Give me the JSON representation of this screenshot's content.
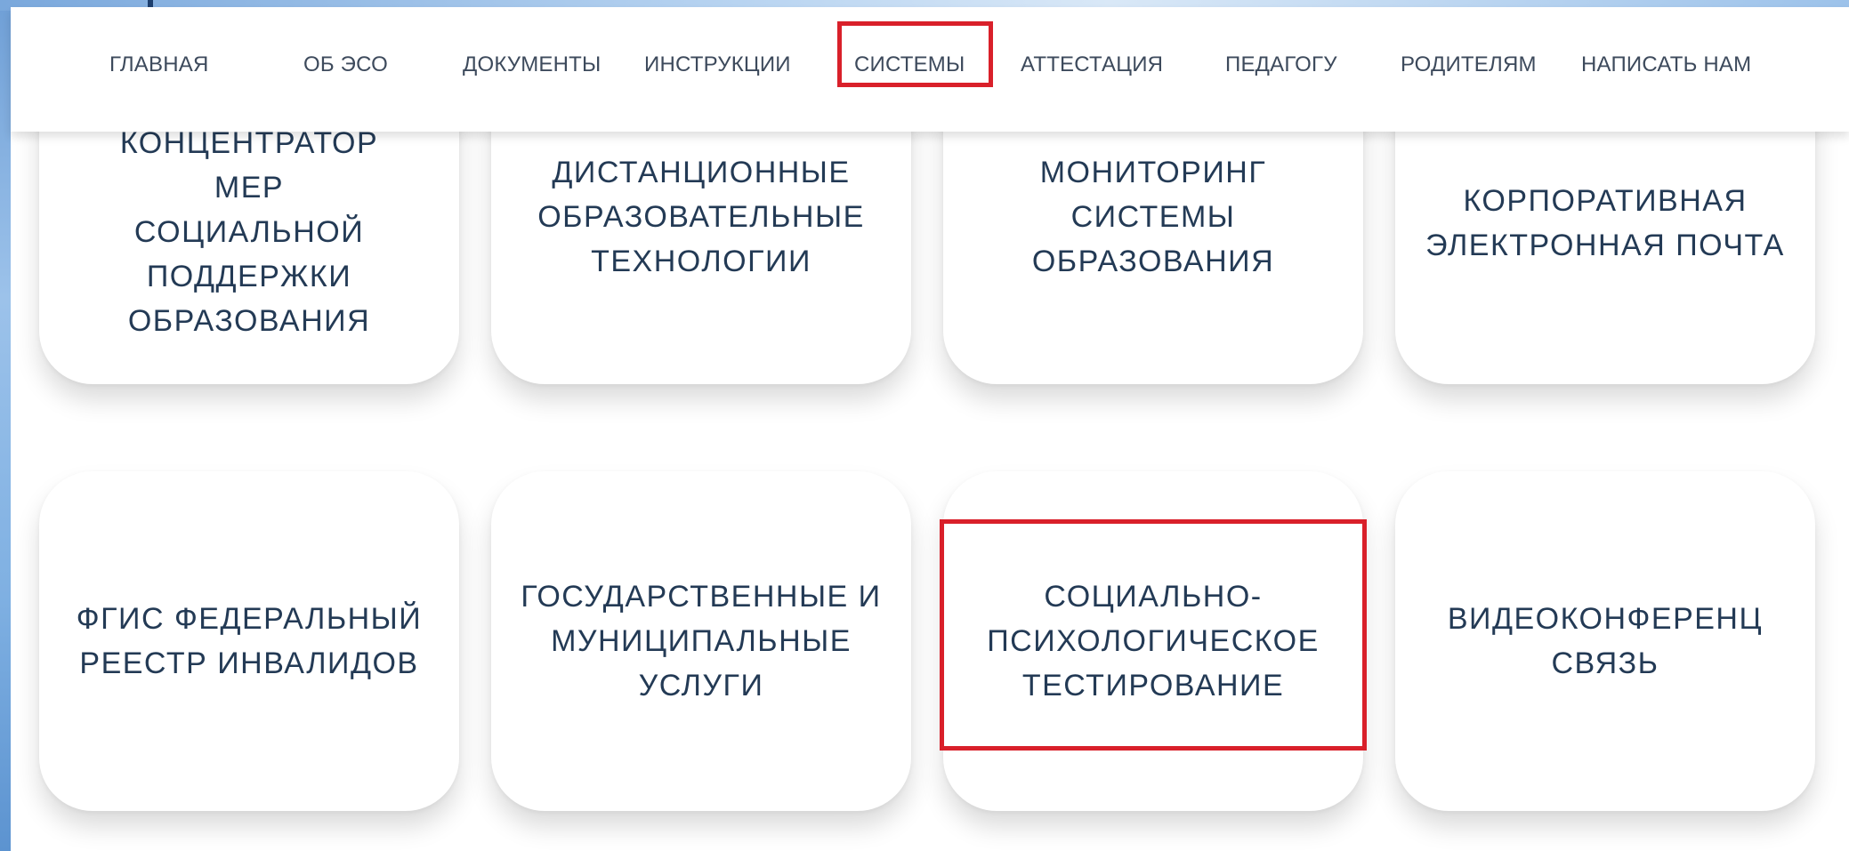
{
  "nav": {
    "items": [
      {
        "label": "ГЛАВНАЯ"
      },
      {
        "label": "ОБ ЭСО"
      },
      {
        "label": "ДОКУМЕНТЫ"
      },
      {
        "label": "ИНСТРУКЦИИ"
      },
      {
        "label": "СИСТЕМЫ",
        "active": true
      },
      {
        "label": "АТТЕСТАЦИЯ"
      },
      {
        "label": "ПЕДАГОГУ"
      },
      {
        "label": "РОДИТЕЛЯМ"
      },
      {
        "label": "НАПИСАТЬ НАМ"
      }
    ]
  },
  "cards": [
    {
      "title": "КОНЦЕНТРАТОР МЕР СОЦИАЛЬНОЙ ПОДДЕРЖКИ ОБРАЗОВАНИЯ"
    },
    {
      "title": "ДИСТАНЦИОННЫЕ ОБРАЗОВАТЕЛЬНЫЕ ТЕХНОЛОГИИ"
    },
    {
      "title": "МОНИТОРИНГ СИСТЕМЫ ОБРАЗОВАНИЯ"
    },
    {
      "title": "КОРПОРАТИВНАЯ ЭЛЕКТРОННАЯ ПОЧТА"
    },
    {
      "title": "ФГИС ФЕДЕРАЛЬНЫЙ РЕЕСТР ИНВАЛИДОВ"
    },
    {
      "title": "ГОСУДАРСТВЕННЫЕ И МУНИЦИПАЛЬНЫЕ УСЛУГИ"
    },
    {
      "title": "СОЦИАЛЬНО-ПСИХОЛОГИЧЕСКОЕ ТЕСТИРОВАНИЕ",
      "highlighted": true
    },
    {
      "title": "ВИДЕОКОНФЕРЕНЦ СВЯЗЬ"
    }
  ],
  "colors": {
    "highlight": "#d9202a",
    "card_text": "#233a55",
    "nav_text": "#3d4a5c",
    "backdrop": "#7fb0e2"
  }
}
